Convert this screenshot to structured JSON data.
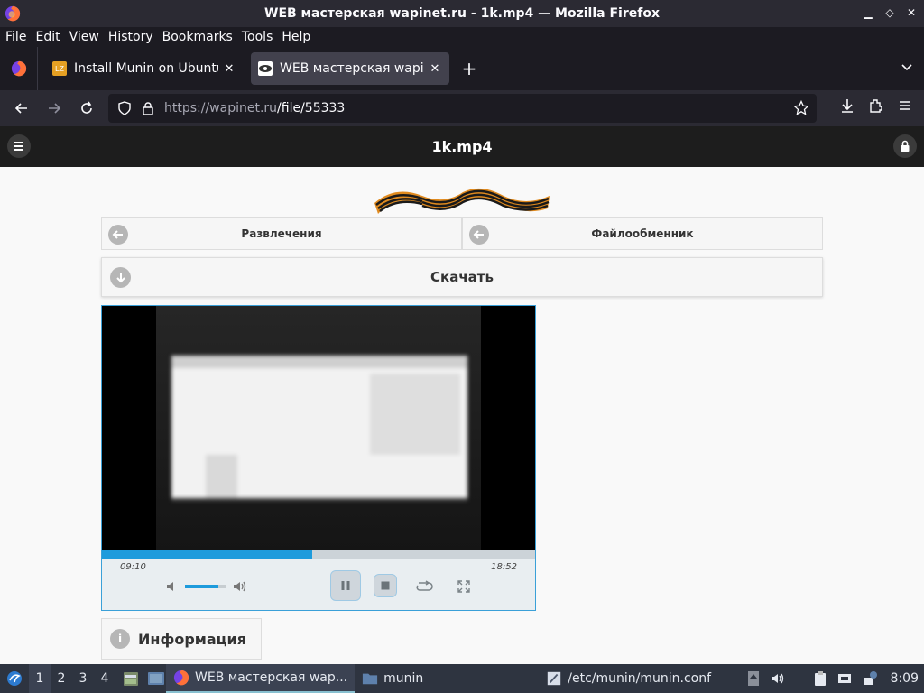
{
  "window": {
    "title": "WEB мастерская wapinet.ru - 1k.mp4 — Mozilla Firefox"
  },
  "menu": [
    "File",
    "Edit",
    "View",
    "History",
    "Bookmarks",
    "Tools",
    "Help"
  ],
  "menu_accel": [
    "F",
    "E",
    "V",
    "H",
    "B",
    "T",
    "H"
  ],
  "tabs": [
    {
      "label": "Install Munin on Ubuntu",
      "active": false
    },
    {
      "label": "WEB мастерская wapinet",
      "active": true
    }
  ],
  "nav": {
    "url_host": "https://wapinet.ru",
    "url_path": "/file/55333"
  },
  "page": {
    "title": "1k.mp4",
    "buttons": {
      "left": "Развлечения",
      "right": "Файлообменник",
      "download": "Скачать"
    },
    "player": {
      "current_time": "09:10",
      "duration": "18:52",
      "progress": 0.486,
      "volume": 0.8
    },
    "info_label": "Информация"
  },
  "taskbar": {
    "workspaces": [
      "1",
      "2",
      "3",
      "4"
    ],
    "active_workspace": 0,
    "tasks": [
      {
        "label": "WEB мастерская wap...",
        "active": true
      },
      {
        "label": "munin",
        "active": false
      },
      {
        "label": "/etc/munin/munin.conf",
        "active": false
      }
    ],
    "clock": "8:09"
  },
  "colors": {
    "accent": "#1e9bdc",
    "titlebar": "#2b2a33",
    "page_header": "#1d1d1d"
  }
}
